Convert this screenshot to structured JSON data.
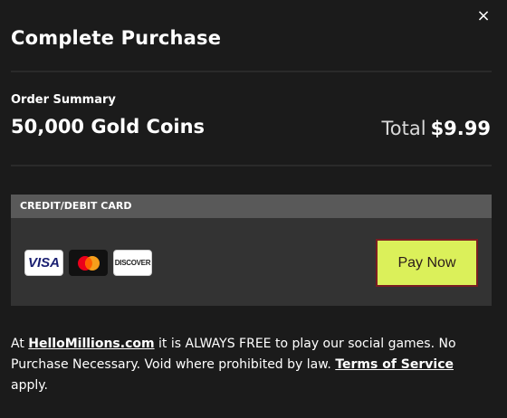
{
  "dialog": {
    "title": "Complete Purchase",
    "close_label": "×"
  },
  "order": {
    "summary_label": "Order Summary",
    "product_name": "50,000 Gold Coins",
    "total_label": "Total",
    "total_amount": "$9.99"
  },
  "payment": {
    "method_label": "CREDIT/DEBIT CARD",
    "cards": [
      {
        "name": "visa-icon",
        "label": "VISA"
      },
      {
        "name": "mastercard-icon",
        "label": ""
      },
      {
        "name": "discover-icon",
        "label": "DISCOVER"
      }
    ],
    "pay_button_label": "Pay Now"
  },
  "disclaimer": {
    "prefix": "At ",
    "site_link": "HelloMillions.com",
    "middle": " it is ALWAYS FREE to play our social games. No Purchase Necessary. Void where prohibited by law. ",
    "terms_link": "Terms of Service",
    "suffix": " apply."
  },
  "colors": {
    "background": "#1b1b1b",
    "panel": "#333333",
    "panel_header": "#595959",
    "pay_button": "#dbf05a",
    "pay_button_border": "#7a1d22",
    "mastercard_red": "#eb001b",
    "mastercard_orange": "#f79e1b"
  }
}
